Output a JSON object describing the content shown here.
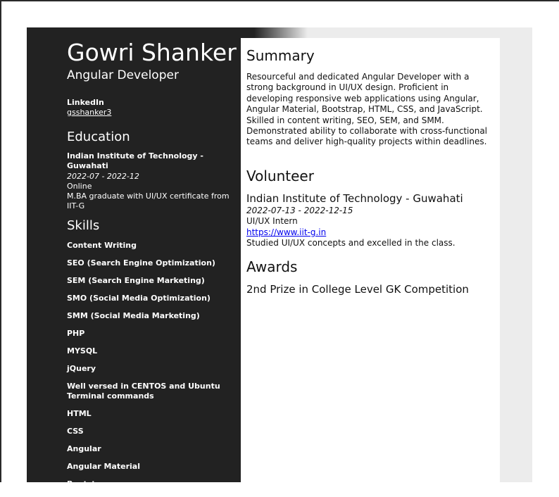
{
  "profile": {
    "name": "Gowri Shanker",
    "title": "Angular Developer"
  },
  "contact": {
    "network_label": "LinkedIn",
    "username": "gsshanker3"
  },
  "education": {
    "heading": "Education",
    "institution": "Indian Institute of Technology - Guwahati",
    "dates": "2022-07 - 2022-12",
    "mode": "Online",
    "description": "M.BA graduate with UI/UX certificate from IIT-G"
  },
  "skills": {
    "heading": "Skills",
    "items": [
      "Content Writing",
      "SEO (Search Engine Optimization)",
      "SEM (Search Engine Marketing)",
      "SMO (Social Media Optimization)",
      "SMM (Social Media Marketing)",
      "PHP",
      "MYSQL",
      "jQuery",
      "Well versed in CENTOS and Ubuntu Terminal commands",
      "HTML",
      "CSS",
      "Angular",
      "Angular Material",
      "Bootstrap"
    ]
  },
  "summary": {
    "heading": "Summary",
    "text": "Resourceful and dedicated Angular Developer with a strong background in UI/UX design. Proficient in developing responsive web applications using Angular, Angular Material, Bootstrap, HTML, CSS, and JavaScript. Skilled in content writing, SEO, SEM, and SMM. Demonstrated ability to collaborate with cross-functional teams and deliver high-quality projects within deadlines."
  },
  "volunteer": {
    "heading": "Volunteer",
    "organization": "Indian Institute of Technology - Guwahati",
    "dates": "2022-07-13 - 2022-12-15",
    "position": "UI/UX Intern",
    "url": "https://www.iit-g.in",
    "summary": "Studied UI/UX concepts and excelled in the class."
  },
  "awards": {
    "heading": "Awards",
    "items": [
      "2nd Prize in College Level GK Competition"
    ]
  },
  "colors": {
    "sidebar_bg": "#222222",
    "page_bg": "#ececec",
    "link": "#0000ee"
  }
}
